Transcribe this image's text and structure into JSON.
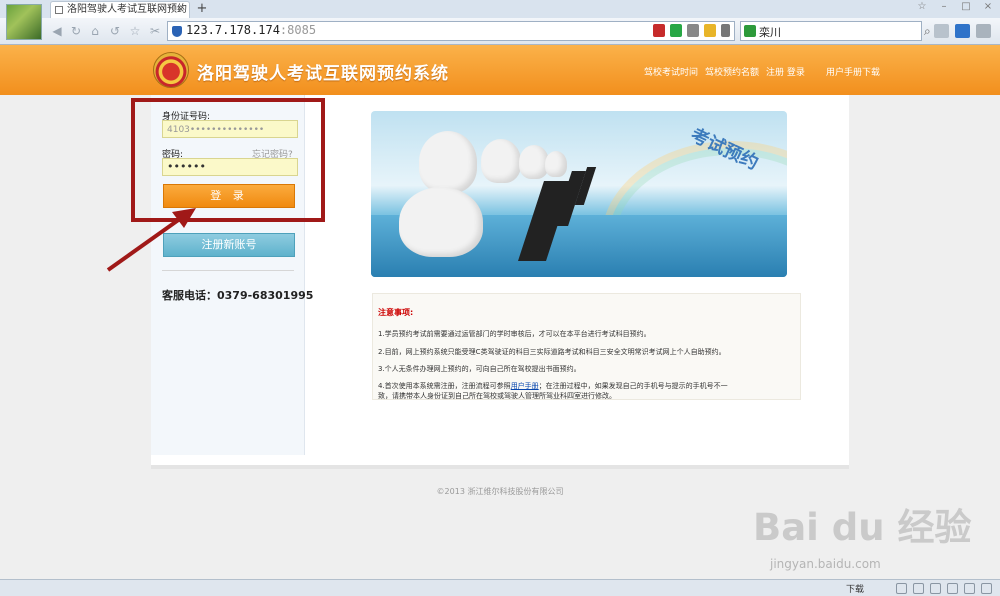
{
  "browser": {
    "tab_title": "洛阳驾驶人考试互联网预约",
    "tab_close": "×",
    "new_tab": "+",
    "url_host": "123.7.178.174",
    "url_port": ":8085",
    "search_value": "栾川",
    "window_controls": [
      "☆",
      "–",
      "□",
      "×"
    ]
  },
  "site": {
    "title": "洛阳驾驶人考试互联网预约系统",
    "nav": [
      "驾校考试时间",
      "驾校预约名额",
      "注册 登录",
      "用户手册下载"
    ]
  },
  "login": {
    "id_label": "身份证号码:",
    "id_value": "4103••••••••••••••",
    "password_label": "密码:",
    "password_value": "••••••",
    "forgot_link": "忘记密码?",
    "login_button": "登 录",
    "register_button": "注册新账号",
    "hotline": "客服电话：0379-68301995"
  },
  "hero": {
    "caption": "考试预约"
  },
  "notice": {
    "title": "注意事项:",
    "items": [
      "1.学员预约考试前需要通过运管部门的学时审核后，才可以在本平台进行考试科目预约。",
      "2.目前，网上预约系统只能受理C类驾驶证的科目三实际道路考试和科目三安全文明常识考试网上个人自助预约。",
      "3.个人无条件办理网上预约的，可向自己所在驾校提出书面预约。"
    ],
    "item4_before": "4.首次使用本系统需注册，注册流程可参照",
    "item4_link": "用户手册",
    "item4_after": "；在注册过程中，如果发现自己的手机号与提示的手机号不一",
    "item4_line2": "致，请携带本人身份证到自己所在驾校或驾驶人管理所驾业科四室进行修改。"
  },
  "footer": {
    "copyright": "©2013 浙江维尔科技股份有限公司"
  },
  "watermark": {
    "brand": "Bai du 经验",
    "url": "jingyan.baidu.com"
  },
  "statusbar": {
    "download_label": "下载"
  },
  "colors": {
    "header_orange": "#f39a26",
    "login_orange": "#f08a10",
    "register_blue": "#5eb2cc",
    "annotation_red": "#a01918",
    "notice_title_red": "#cc0000"
  }
}
